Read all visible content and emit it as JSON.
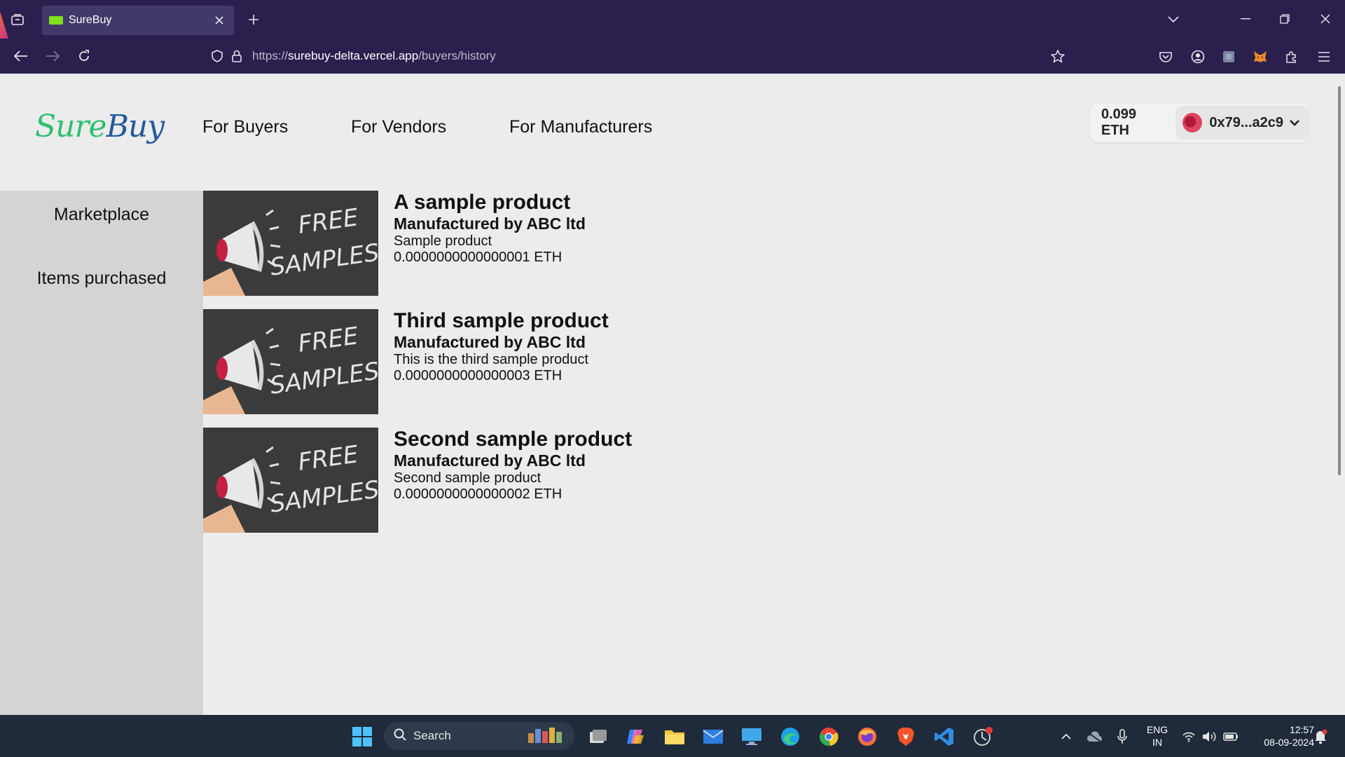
{
  "browser": {
    "tab_title": "SureBuy",
    "url_prefix": "https://",
    "url_host": "surebuy-delta.vercel.app",
    "url_path": "/buyers/history"
  },
  "header": {
    "logo_sure": "Sure",
    "logo_buy": "Buy",
    "nav": [
      "For Buyers",
      "For Vendors",
      "For Manufacturers"
    ],
    "balance": "0.099 ETH",
    "account": "0x79...a2c9"
  },
  "sidebar": {
    "items": [
      "Marketplace",
      "Items purchased"
    ]
  },
  "products": [
    {
      "name": "A sample product",
      "manufacturer": "Manufactured by ABC ltd",
      "description": "Sample product",
      "price": "0.0000000000000001 ETH",
      "image_text": [
        "FREE",
        "SAMPLES"
      ]
    },
    {
      "name": "Third sample product",
      "manufacturer": "Manufactured by ABC ltd",
      "description": "This is the third sample product",
      "price": "0.0000000000000003 ETH",
      "image_text": [
        "FREE",
        "SAMPLES"
      ]
    },
    {
      "name": "Second sample product",
      "manufacturer": "Manufactured by ABC ltd",
      "description": "Second sample product",
      "price": "0.0000000000000002 ETH",
      "image_text": [
        "FREE",
        "SAMPLES"
      ]
    }
  ],
  "taskbar": {
    "search_label": "Search",
    "lang_line1": "ENG",
    "lang_line2": "IN",
    "time": "12:57",
    "date": "08-09-2024"
  },
  "colors": {
    "browser_chrome": "#2b1f4d",
    "logo_sure": "#2fbf71",
    "logo_buy": "#245a9e",
    "sidebar": "#d4d4d4",
    "page_bg": "#ececec",
    "taskbar": "#1f2a3a"
  }
}
